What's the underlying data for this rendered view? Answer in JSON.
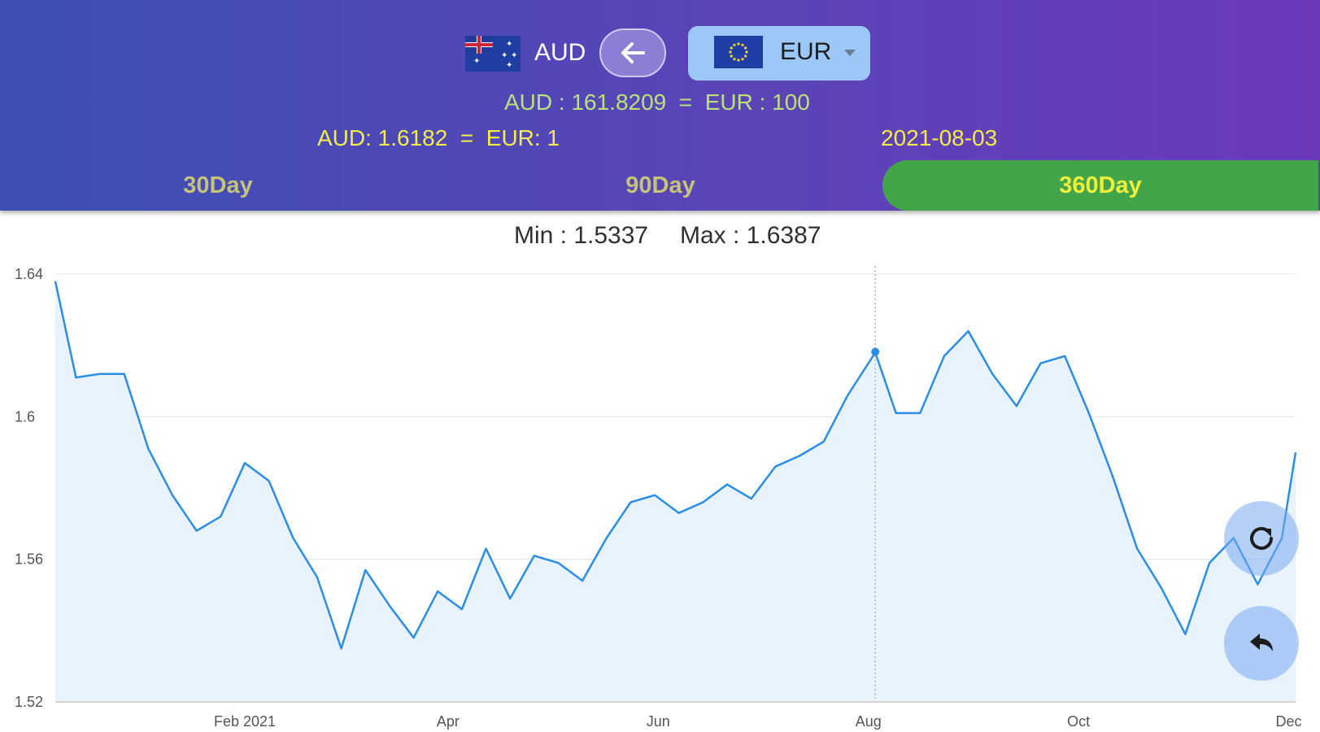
{
  "header": {
    "from_code": "AUD",
    "to_code": "EUR",
    "rate_line_100": "AUD : 161.8209  =  EUR : 100",
    "rate_line_1": "AUD: 1.6182  =  EUR: 1",
    "selected_date": "2021-08-03"
  },
  "tabs": [
    {
      "label": "30Day",
      "active": false
    },
    {
      "label": "90Day",
      "active": false
    },
    {
      "label": "360Day",
      "active": true
    }
  ],
  "stats": {
    "min_text": "Min : 1.5337",
    "max_text": "Max : 1.6387"
  },
  "icons": {
    "swap": "arrow-left-icon",
    "refresh": "refresh-icon",
    "back": "reply-icon"
  },
  "colors": {
    "line": "#2b8ee6",
    "fill": "#e8f3fd",
    "active_tab": "#43a54a",
    "rate_text": "#b9e27a",
    "date_text": "#f4ec4b"
  },
  "chart_data": {
    "type": "area",
    "title": "",
    "xlabel": "",
    "ylabel": "",
    "ylim": [
      1.52,
      1.64
    ],
    "y_ticks": [
      "1.64",
      "1.6",
      "1.56",
      "1.52"
    ],
    "x_ticks": [
      "Feb 2021",
      "Apr",
      "Jun",
      "Aug",
      "Oct",
      "Dec"
    ],
    "x_range": [
      "2020-12-08",
      "2021-12-03"
    ],
    "highlight": {
      "date": "2021-08-03",
      "value": 1.6182
    },
    "series": [
      {
        "x": [
          "2020-12-08",
          "2020-12-14",
          "2020-12-21",
          "2020-12-28",
          "2021-01-04",
          "2021-01-11",
          "2021-01-18",
          "2021-01-25",
          "2021-02-01",
          "2021-02-08",
          "2021-02-15",
          "2021-02-22",
          "2021-03-01",
          "2021-03-08",
          "2021-03-15",
          "2021-03-22",
          "2021-03-29",
          "2021-04-05",
          "2021-04-12",
          "2021-04-19",
          "2021-04-26",
          "2021-05-03",
          "2021-05-10",
          "2021-05-17",
          "2021-05-24",
          "2021-05-31",
          "2021-06-07",
          "2021-06-14",
          "2021-06-21",
          "2021-06-28",
          "2021-07-05",
          "2021-07-12",
          "2021-07-19",
          "2021-07-26",
          "2021-08-03",
          "2021-08-09",
          "2021-08-16",
          "2021-08-23",
          "2021-08-30",
          "2021-09-06",
          "2021-09-13",
          "2021-09-20",
          "2021-09-27",
          "2021-10-04",
          "2021-10-11",
          "2021-10-18",
          "2021-10-25",
          "2021-11-01",
          "2021-11-08",
          "2021-11-15",
          "2021-11-22",
          "2021-11-29",
          "2021-12-03"
        ],
        "values": [
          1.638,
          1.611,
          1.612,
          1.612,
          1.591,
          1.578,
          1.568,
          1.572,
          1.587,
          1.582,
          1.566,
          1.555,
          1.535,
          1.557,
          1.547,
          1.538,
          1.551,
          1.546,
          1.563,
          1.549,
          1.561,
          1.559,
          1.554,
          1.566,
          1.576,
          1.578,
          1.573,
          1.576,
          1.581,
          1.577,
          1.586,
          1.589,
          1.593,
          1.606,
          1.618,
          1.601,
          1.601,
          1.617,
          1.624,
          1.612,
          1.603,
          1.615,
          1.617,
          1.601,
          1.583,
          1.563,
          1.552,
          1.539,
          1.559,
          1.566,
          1.553,
          1.566,
          1.59
        ]
      }
    ]
  }
}
